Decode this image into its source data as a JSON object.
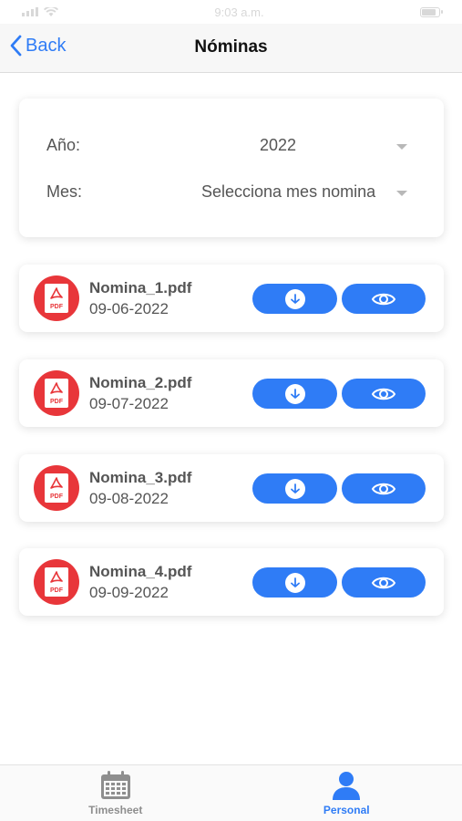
{
  "status_bar": {
    "time": "9:03 a.m."
  },
  "nav": {
    "back_label": "Back",
    "title": "Nóminas"
  },
  "filters": {
    "year_label": "Año:",
    "year_value": "2022",
    "month_label": "Mes:",
    "month_value": "Selecciona mes nomina"
  },
  "files": [
    {
      "name": "Nomina_1.pdf",
      "date": "09-06-2022",
      "icon": "pdf-icon"
    },
    {
      "name": "Nomina_2.pdf",
      "date": "09-07-2022",
      "icon": "pdf-icon"
    },
    {
      "name": "Nomina_3.pdf",
      "date": "09-08-2022",
      "icon": "pdf-icon"
    },
    {
      "name": "Nomina_4.pdf",
      "date": "09-09-2022",
      "icon": "pdf-icon"
    }
  ],
  "pdf_badge": "PDF",
  "tabbar": {
    "timesheet_label": "Timesheet",
    "personal_label": "Personal",
    "active": "Personal"
  },
  "colors": {
    "accent": "#2f7cf6",
    "pdf_red": "#e8363a",
    "inactive": "#8e8e8e"
  }
}
